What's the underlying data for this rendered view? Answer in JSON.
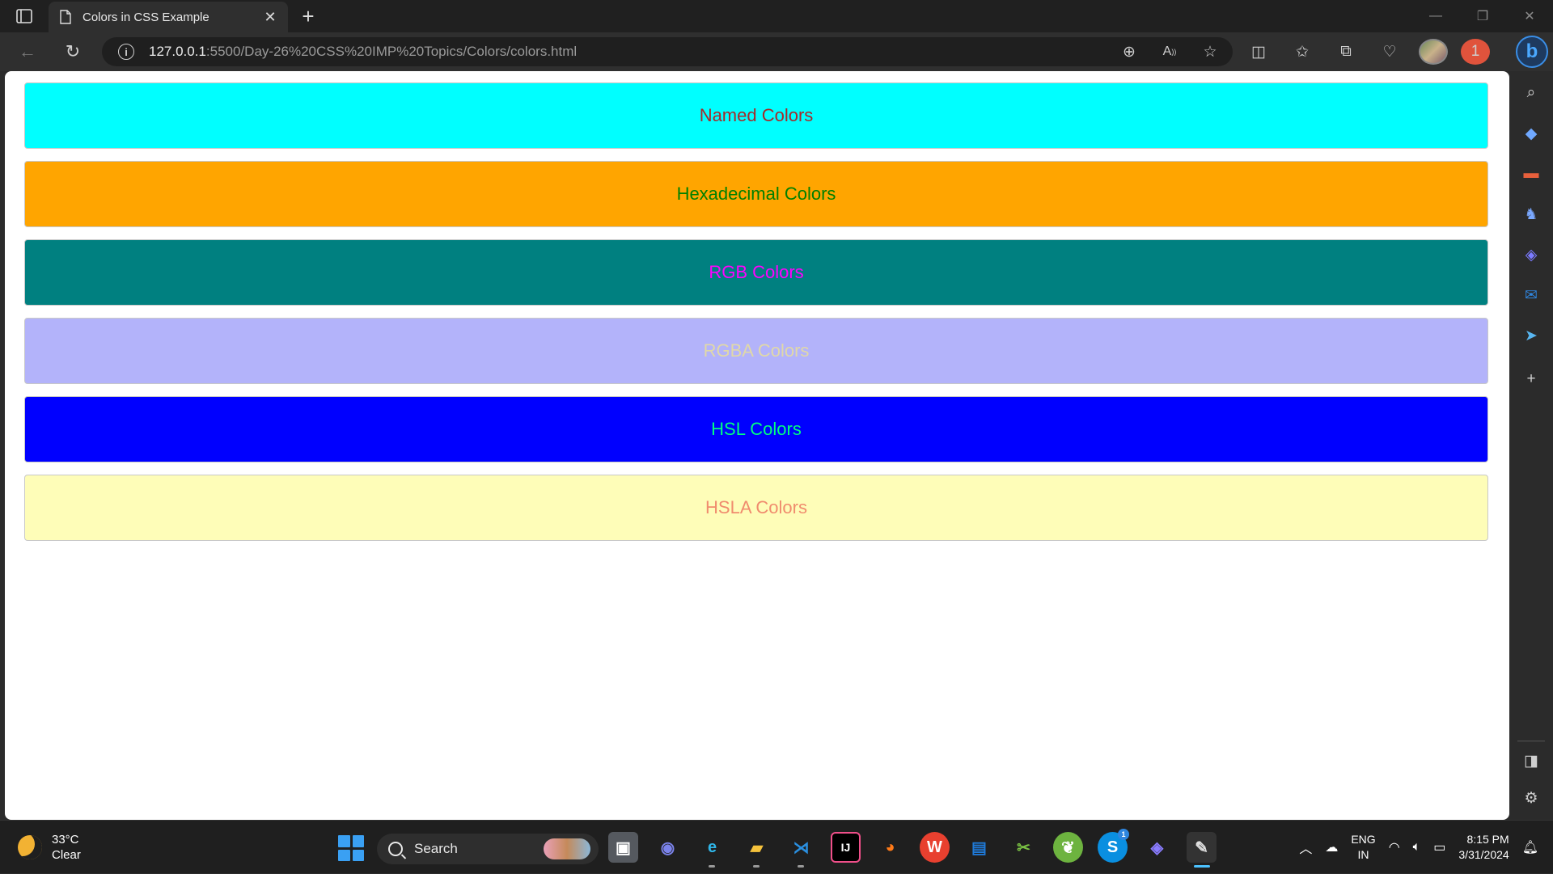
{
  "browser": {
    "tab_title": "Colors in CSS Example",
    "url_host": "127.0.0.1",
    "url_rest": ":5500/Day-26%20CSS%20IMP%20Topics/Colors/colors.html",
    "notification_count": "1"
  },
  "page": {
    "boxes": [
      {
        "label": "Named Colors",
        "background": "#00ffff",
        "text_color": "#a52a2a"
      },
      {
        "label": "Hexadecimal Colors",
        "background": "#ffa500",
        "text_color": "#008000"
      },
      {
        "label": "RGB Colors",
        "background": "#008080",
        "text_color": "#ff00ff"
      },
      {
        "label": "RGBA Colors",
        "background": "#b3b3fa",
        "text_color": "#e0d8a8"
      },
      {
        "label": "HSL Colors",
        "background": "#0000ff",
        "text_color": "#00ff7f"
      },
      {
        "label": "HSLA Colors",
        "background": "#fefdb8",
        "text_color": "#f08c6e"
      }
    ]
  },
  "taskbar": {
    "temperature": "33°C",
    "condition": "Clear",
    "search_placeholder": "Search",
    "lang_line1": "ENG",
    "lang_line2": "IN",
    "time": "8:15 PM",
    "date": "3/31/2024",
    "skype_badge": "1"
  },
  "icons": {
    "accent": "#3aa0f3"
  }
}
